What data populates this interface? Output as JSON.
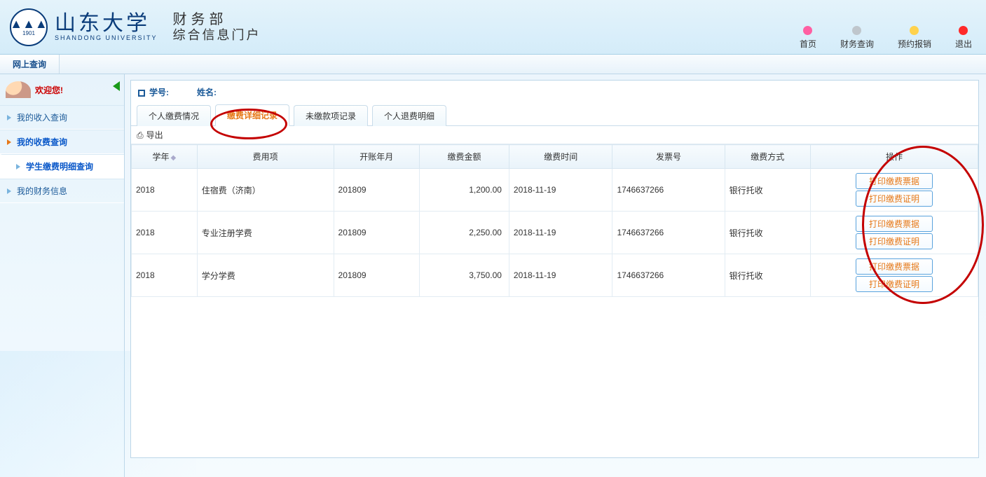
{
  "header": {
    "univ_cn": "山东大学",
    "univ_en": "SHANDONG UNIVERSITY",
    "seal_year": "1901",
    "dept": "财务部",
    "dept_sub": "综合信息门户"
  },
  "topnav": [
    {
      "label": "首页",
      "color": "#ff5fa2"
    },
    {
      "label": "财务查询",
      "color": "#bfc6cc"
    },
    {
      "label": "预约报销",
      "color": "#ffd24d"
    },
    {
      "label": "退出",
      "color": "#ff2a2a"
    }
  ],
  "subheader_tab": "网上查询",
  "welcome": "欢迎您!",
  "side_menu": [
    {
      "label": "我的收入查询",
      "cls": ""
    },
    {
      "label": "我的收费查询",
      "cls": "active-blue"
    },
    {
      "label": "学生缴费明细查询",
      "cls": "sub-active"
    },
    {
      "label": "我的财务信息",
      "cls": ""
    }
  ],
  "info": {
    "id_label": "学号:",
    "id_value": "",
    "name_label": "姓名:",
    "name_value": ""
  },
  "tabs": [
    {
      "label": "个人缴费情况",
      "active": false
    },
    {
      "label": "缴费详细记录",
      "active": true
    },
    {
      "label": "未缴款项记录",
      "active": false
    },
    {
      "label": "个人退费明细",
      "active": false
    }
  ],
  "export_label": "导出",
  "columns": [
    "学年",
    "费用项",
    "开账年月",
    "缴费金额",
    "缴费时间",
    "发票号",
    "缴费方式",
    "操作"
  ],
  "action_labels": {
    "receipt": "打印缴费票据",
    "proof": "打印缴费证明"
  },
  "rows": [
    {
      "year": "2018",
      "item": "住宿费（济南）",
      "period": "201809",
      "amount": "1,200.00",
      "time": "2018-11-19",
      "invoice": "1746637266",
      "method": "银行托收"
    },
    {
      "year": "2018",
      "item": "专业注册学费",
      "period": "201809",
      "amount": "2,250.00",
      "time": "2018-11-19",
      "invoice": "1746637266",
      "method": "银行托收"
    },
    {
      "year": "2018",
      "item": "学分学费",
      "period": "201809",
      "amount": "3,750.00",
      "time": "2018-11-19",
      "invoice": "1746637266",
      "method": "银行托收"
    }
  ]
}
